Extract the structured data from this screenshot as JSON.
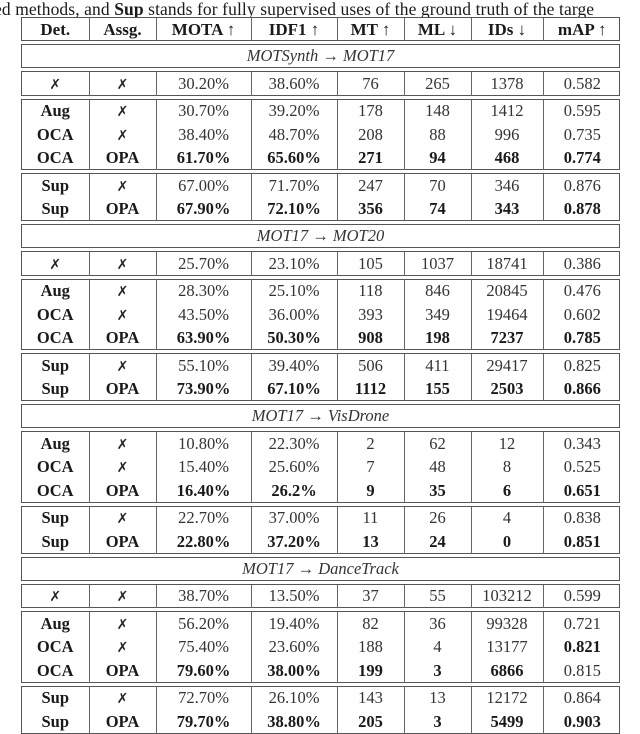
{
  "caption": {
    "prefix": "ed methods, and ",
    "bold": "Sup",
    "suffix": " stands for fully supervised uses of the ground truth of the targe"
  },
  "header": [
    "Det.",
    "Assg.",
    "MOTA ↑",
    "IDF1 ↑",
    "MT ↑",
    "ML ↓",
    "IDs ↓",
    "mAP ↑"
  ],
  "cross_symbol": "✗",
  "sections": [
    {
      "title": "MOTSynth → MOT17",
      "groups": [
        [
          {
            "cells": [
              "✗",
              "✗",
              "30.20%",
              "38.60%",
              "76",
              "265",
              "1378",
              "0.582"
            ],
            "bold": [
              false,
              false,
              false,
              false,
              false,
              false,
              false,
              false
            ]
          }
        ],
        [
          {
            "cells": [
              "Aug",
              "✗",
              "30.70%",
              "39.20%",
              "178",
              "148",
              "1412",
              "0.595"
            ],
            "bold": [
              true,
              false,
              false,
              false,
              false,
              false,
              false,
              false
            ]
          },
          {
            "cells": [
              "OCA",
              "✗",
              "38.40%",
              "48.70%",
              "208",
              "88",
              "996",
              "0.735"
            ],
            "bold": [
              true,
              false,
              false,
              false,
              false,
              false,
              false,
              false
            ]
          },
          {
            "cells": [
              "OCA",
              "OPA",
              "61.70%",
              "65.60%",
              "271",
              "94",
              "468",
              "0.774"
            ],
            "bold": [
              true,
              true,
              true,
              true,
              true,
              true,
              true,
              true
            ]
          }
        ],
        [
          {
            "cells": [
              "Sup",
              "✗",
              "67.00%",
              "71.70%",
              "247",
              "70",
              "346",
              "0.876"
            ],
            "bold": [
              true,
              false,
              false,
              false,
              false,
              false,
              false,
              false
            ]
          },
          {
            "cells": [
              "Sup",
              "OPA",
              "67.90%",
              "72.10%",
              "356",
              "74",
              "343",
              "0.878"
            ],
            "bold": [
              true,
              true,
              true,
              true,
              true,
              true,
              true,
              true
            ]
          }
        ]
      ]
    },
    {
      "title": "MOT17 → MOT20",
      "groups": [
        [
          {
            "cells": [
              "✗",
              "✗",
              "25.70%",
              "23.10%",
              "105",
              "1037",
              "18741",
              "0.386"
            ],
            "bold": [
              false,
              false,
              false,
              false,
              false,
              false,
              false,
              false
            ]
          }
        ],
        [
          {
            "cells": [
              "Aug",
              "✗",
              "28.30%",
              "25.10%",
              "118",
              "846",
              "20845",
              "0.476"
            ],
            "bold": [
              true,
              false,
              false,
              false,
              false,
              false,
              false,
              false
            ]
          },
          {
            "cells": [
              "OCA",
              "✗",
              "43.50%",
              "36.00%",
              "393",
              "349",
              "19464",
              "0.602"
            ],
            "bold": [
              true,
              false,
              false,
              false,
              false,
              false,
              false,
              false
            ]
          },
          {
            "cells": [
              "OCA",
              "OPA",
              "63.90%",
              "50.30%",
              "908",
              "198",
              "7237",
              "0.785"
            ],
            "bold": [
              true,
              true,
              true,
              true,
              true,
              true,
              true,
              true
            ]
          }
        ],
        [
          {
            "cells": [
              "Sup",
              "✗",
              "55.10%",
              "39.40%",
              "506",
              "411",
              "29417",
              "0.825"
            ],
            "bold": [
              true,
              false,
              false,
              false,
              false,
              false,
              false,
              false
            ]
          },
          {
            "cells": [
              "Sup",
              "OPA",
              "73.90%",
              "67.10%",
              "1112",
              "155",
              "2503",
              "0.866"
            ],
            "bold": [
              true,
              true,
              true,
              true,
              true,
              true,
              true,
              true
            ]
          }
        ]
      ]
    },
    {
      "title": "MOT17 → VisDrone",
      "groups": [
        [
          {
            "cells": [
              "Aug",
              "✗",
              "10.80%",
              "22.30%",
              "2",
              "62",
              "12",
              "0.343"
            ],
            "bold": [
              true,
              false,
              false,
              false,
              false,
              false,
              false,
              false
            ]
          },
          {
            "cells": [
              "OCA",
              "✗",
              "15.40%",
              "25.60%",
              "7",
              "48",
              "8",
              "0.525"
            ],
            "bold": [
              true,
              false,
              false,
              false,
              false,
              false,
              false,
              false
            ]
          },
          {
            "cells": [
              "OCA",
              "OPA",
              "16.40%",
              "26.2%",
              "9",
              "35",
              "6",
              "0.651"
            ],
            "bold": [
              true,
              true,
              true,
              true,
              true,
              true,
              true,
              true
            ]
          }
        ],
        [
          {
            "cells": [
              "Sup",
              "✗",
              "22.70%",
              "37.00%",
              "11",
              "26",
              "4",
              "0.838"
            ],
            "bold": [
              true,
              false,
              false,
              false,
              false,
              false,
              false,
              false
            ]
          },
          {
            "cells": [
              "Sup",
              "OPA",
              "22.80%",
              "37.20%",
              "13",
              "24",
              "0",
              "0.851"
            ],
            "bold": [
              true,
              true,
              true,
              true,
              true,
              true,
              true,
              true
            ]
          }
        ]
      ]
    },
    {
      "title": "MOT17 → DanceTrack",
      "groups": [
        [
          {
            "cells": [
              "✗",
              "✗",
              "38.70%",
              "13.50%",
              "37",
              "55",
              "103212",
              "0.599"
            ],
            "bold": [
              false,
              false,
              false,
              false,
              false,
              false,
              false,
              false
            ]
          }
        ],
        [
          {
            "cells": [
              "Aug",
              "✗",
              "56.20%",
              "19.40%",
              "82",
              "36",
              "99328",
              "0.721"
            ],
            "bold": [
              true,
              false,
              false,
              false,
              false,
              false,
              false,
              false
            ]
          },
          {
            "cells": [
              "OCA",
              "✗",
              "75.40%",
              "23.60%",
              "188",
              "4",
              "13177",
              "0.821"
            ],
            "bold": [
              true,
              false,
              false,
              false,
              false,
              false,
              false,
              true
            ]
          },
          {
            "cells": [
              "OCA",
              "OPA",
              "79.60%",
              "38.00%",
              "199",
              "3",
              "6866",
              "0.815"
            ],
            "bold": [
              true,
              true,
              true,
              true,
              true,
              true,
              true,
              false
            ]
          }
        ],
        [
          {
            "cells": [
              "Sup",
              "✗",
              "72.70%",
              "26.10%",
              "143",
              "13",
              "12172",
              "0.864"
            ],
            "bold": [
              true,
              false,
              false,
              false,
              false,
              false,
              false,
              false
            ]
          },
          {
            "cells": [
              "Sup",
              "OPA",
              "79.70%",
              "38.80%",
              "205",
              "3",
              "5499",
              "0.903"
            ],
            "bold": [
              true,
              true,
              true,
              true,
              true,
              true,
              true,
              true
            ]
          }
        ]
      ]
    }
  ]
}
